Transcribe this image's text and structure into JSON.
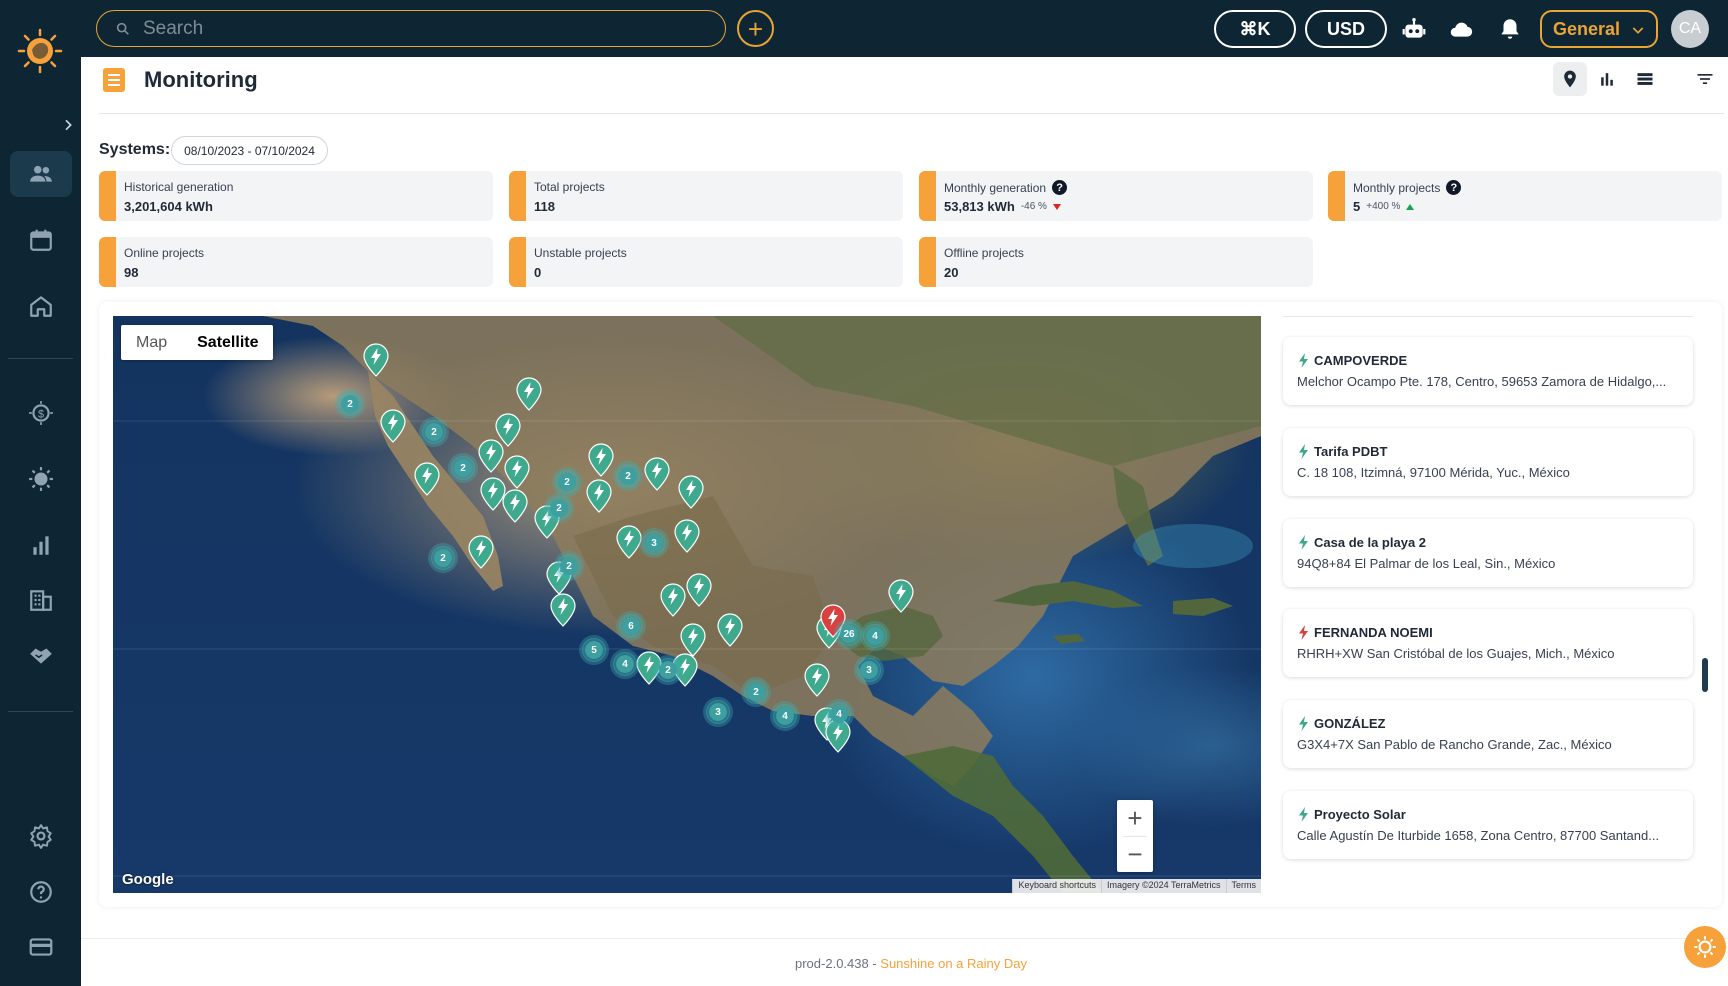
{
  "topbar": {
    "search_placeholder": "Search",
    "shortcut_label": "⌘K",
    "currency_label": "USD",
    "workspace_label": "General",
    "avatar_initials": "CA",
    "accent_color": "#e8a435"
  },
  "sidebar": {
    "items": [
      {
        "icon": "users-icon",
        "active": true
      },
      {
        "icon": "calendar-icon"
      },
      {
        "icon": "home-icon"
      },
      {
        "icon": "dollar-sun-icon"
      },
      {
        "icon": "sun-icon"
      },
      {
        "icon": "bar-chart-icon"
      },
      {
        "icon": "building-icon"
      },
      {
        "icon": "handshake-icon"
      },
      {
        "icon": "gear-icon"
      },
      {
        "icon": "help-icon"
      },
      {
        "icon": "credit-card-icon"
      }
    ]
  },
  "header": {
    "title": "Monitoring",
    "views": [
      "map-pin-icon",
      "bar-chart-icon",
      "list-icon"
    ],
    "active_view": "map-pin-icon"
  },
  "systems": {
    "label": "Systems:",
    "date_range": "08/10/2023 - 07/10/2024"
  },
  "stats": [
    {
      "label": "Historical generation",
      "value": "3,201,604 kWh"
    },
    {
      "label": "Total projects",
      "value": "118"
    },
    {
      "label": "Monthly generation",
      "value": "53,813 kWh",
      "delta": "-46 %",
      "trend": "down",
      "help": "?"
    },
    {
      "label": "Monthly projects",
      "value": "5",
      "delta": "+400 %",
      "trend": "up",
      "help": "?"
    },
    {
      "label": "Online projects",
      "value": "98"
    },
    {
      "label": "Unstable projects",
      "value": "0"
    },
    {
      "label": "Offline projects",
      "value": "20"
    }
  ],
  "map": {
    "type_options": [
      "Map",
      "Satellite"
    ],
    "selected_type": "Satellite",
    "zoom_in": "+",
    "zoom_out": "−",
    "brand": "Google",
    "attribution": [
      "Keyboard shortcuts",
      "Imagery ©2024 TerraMetrics",
      "Terms"
    ],
    "marker_color_online": "#3ea98d",
    "marker_color_offline": "#d94040",
    "clusters": [
      "2",
      "2",
      "2",
      "2",
      "2",
      "2",
      "2",
      "3",
      "2",
      "6",
      "5",
      "4",
      "2",
      "3",
      "2",
      "4",
      "26",
      "4",
      "3",
      "4"
    ]
  },
  "projects": [
    {
      "name": "CAMPOVERDE",
      "address": "Melchor Ocampo Pte. 178, Centro, 59653 Zamora de Hidalgo,...",
      "status": "online"
    },
    {
      "name": "Tarifa PDBT",
      "address": "C. 18 108, Itzimná, 97100 Mérida, Yuc., México",
      "status": "online"
    },
    {
      "name": "Casa de la playa 2",
      "address": "94Q8+84 El Palmar de los Leal, Sin., México",
      "status": "online"
    },
    {
      "name": "FERNANDA NOEMI",
      "address": "RHRH+XW San Cristóbal de los Guajes, Mich., México",
      "status": "offline"
    },
    {
      "name": "GONZÁLEZ",
      "address": "G3X4+7X San Pablo de Rancho Grande, Zac., México",
      "status": "online"
    },
    {
      "name": "Proyecto Solar",
      "address": "Calle Agustín De Iturbide 1658, Zona Centro, 87700 Santand...",
      "status": "online"
    }
  ],
  "footer": {
    "version": "prod-2.0.438 - ",
    "tagline": "Sunshine on a Rainy Day"
  }
}
